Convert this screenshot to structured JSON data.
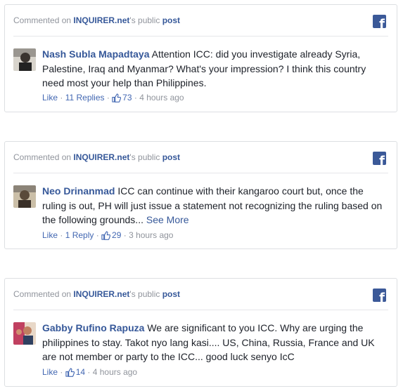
{
  "posts": [
    {
      "header": {
        "commented_on": "Commented on ",
        "publisher": "INQUIRER.net",
        "possessive": "'s public ",
        "post": "post"
      },
      "author": "Nash Subla Mapadtaya",
      "text": "Attention ICC: did you investigate already Syria, Palestine, Iraq and Myanmar? What's your impression? I think this country need most your help than Philippines.",
      "see_more": "",
      "like": "Like",
      "replies": "11 Replies",
      "likes_count": "73",
      "time": "4 hours ago",
      "avatar_colors": [
        "#2b2b2b",
        "#7a6a5a"
      ]
    },
    {
      "header": {
        "commented_on": "Commented on ",
        "publisher": "INQUIRER.net",
        "possessive": "'s public ",
        "post": "post"
      },
      "author": "Neo Drinanmad",
      "text": "ICC can continue with their kangaroo court but, once the ruling is out, PH will just issue a statement not recognizing the ruling based on the following grounds...",
      "see_more": "See More",
      "like": "Like",
      "replies": "1 Reply",
      "likes_count": "29",
      "time": "3 hours ago",
      "avatar_colors": [
        "#c9b8a0",
        "#4a3c30"
      ]
    },
    {
      "header": {
        "commented_on": "Commented on ",
        "publisher": "INQUIRER.net",
        "possessive": "'s public ",
        "post": "post"
      },
      "author": "Gabby Rufino Rapuza",
      "text": "We are significant to you ICC. Why are urging the philippines to stay. Takot nyo lang kasi.... US, China, Russia, France and UK are not member or party to the ICC... good luck senyo IcC",
      "see_more": "",
      "like": "Like",
      "replies": "",
      "likes_count": "14",
      "time": "4 hours ago",
      "avatar_colors": [
        "#b03050",
        "#e0a070"
      ]
    }
  ],
  "separator": " · ",
  "facebook_icon_glyph": "f",
  "colors": {
    "link": "#365899",
    "action": "#4267b2",
    "meta": "#90949c",
    "fb": "#3b5998"
  }
}
